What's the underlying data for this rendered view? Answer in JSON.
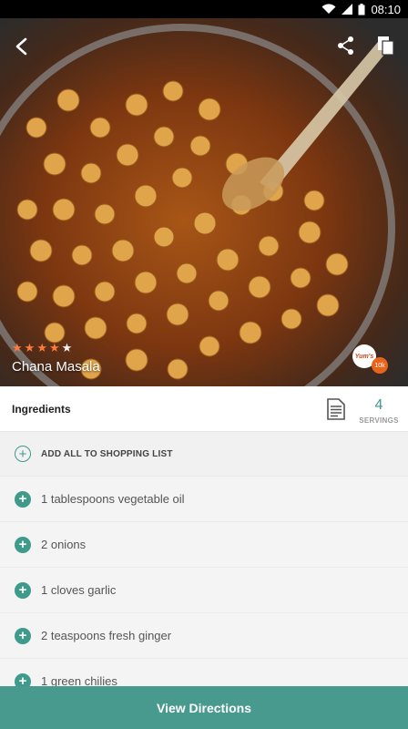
{
  "status_bar": {
    "time": "08:10"
  },
  "hero": {
    "rating": {
      "value": 4,
      "max": 5
    },
    "title": "Chana Masala",
    "source_badge": "Yum's",
    "source_count": "10k"
  },
  "ingredients_header": {
    "title": "Ingredients",
    "servings_count": "4",
    "servings_label": "SERVINGS"
  },
  "add_all_label": "ADD ALL TO SHOPPING LIST",
  "ingredients": [
    "1 tablespoons vegetable oil",
    "2 onions",
    "1 cloves garlic",
    "2 teaspoons fresh ginger",
    "1 green chilies"
  ],
  "footer": {
    "view_directions_label": "View Directions"
  },
  "colors": {
    "accent": "#479a8d",
    "star": "#ff7a3d",
    "badge": "#e8631c"
  }
}
